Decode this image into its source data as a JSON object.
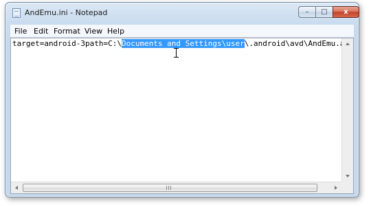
{
  "window": {
    "title": "AndEmu.ini - Notepad",
    "icon": "notepad-icon",
    "controls": {
      "minimize": "–",
      "maximize": "□",
      "close": "x"
    }
  },
  "menu": {
    "items": [
      "File",
      "Edit",
      "Format",
      "View",
      "Help"
    ]
  },
  "editor": {
    "line_before": "target=android-3path=C:\\",
    "selected_text": "Documents and Settings\\user",
    "line_after": "\\.android\\avd\\AndEmu.avd",
    "selection_color": "#3399ff"
  },
  "scrollbars": {
    "horizontal_grip": "|||"
  }
}
